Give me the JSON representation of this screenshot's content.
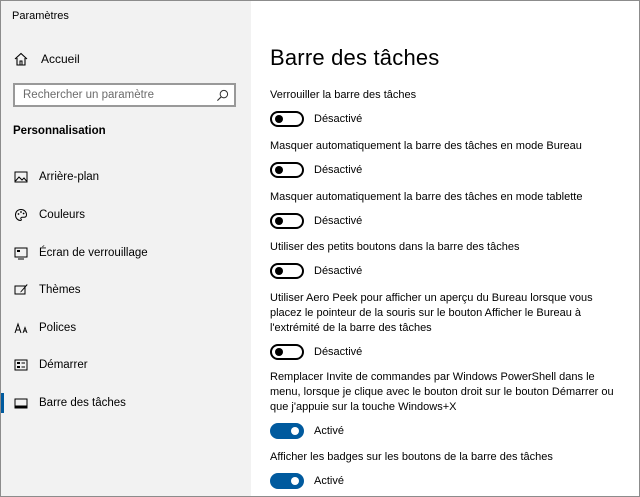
{
  "window": {
    "title": "Paramètres"
  },
  "sidebar": {
    "home_label": "Accueil",
    "search_placeholder": "Rechercher un paramètre",
    "section_title": "Personnalisation",
    "items": [
      {
        "label": "Arrière-plan",
        "icon": "picture-icon"
      },
      {
        "label": "Couleurs",
        "icon": "palette-icon"
      },
      {
        "label": "Écran de verrouillage",
        "icon": "lock-screen-icon"
      },
      {
        "label": "Thèmes",
        "icon": "brush-icon"
      },
      {
        "label": "Polices",
        "icon": "font-icon"
      },
      {
        "label": "Démarrer",
        "icon": "start-icon"
      },
      {
        "label": "Barre des tâches",
        "icon": "taskbar-icon",
        "active": true
      }
    ]
  },
  "main": {
    "title": "Barre des tâches",
    "settings": [
      {
        "description": "Verrouiller la barre des tâches",
        "state": "Désactivé",
        "on": false
      },
      {
        "description": "Masquer automatiquement la barre des tâches en mode Bureau",
        "state": "Désactivé",
        "on": false
      },
      {
        "description": "Masquer automatiquement la barre des tâches en mode tablette",
        "state": "Désactivé",
        "on": false
      },
      {
        "description": "Utiliser des petits boutons dans la barre des tâches",
        "state": "Désactivé",
        "on": false
      },
      {
        "description": "Utiliser Aero Peek pour afficher un aperçu du Bureau lorsque vous placez le pointeur de la souris sur le bouton Afficher le Bureau à l'extrémité de la barre des tâches",
        "state": "Désactivé",
        "on": false
      },
      {
        "description": "Remplacer Invite de commandes par Windows PowerShell dans le menu, lorsque je clique avec le bouton droit sur le bouton Démarrer ou que j'appuie sur la touche Windows+X",
        "state": "Activé",
        "on": true
      },
      {
        "description": "Afficher les badges sur les boutons de la barre des tâches",
        "state": "Activé",
        "on": true
      }
    ]
  },
  "colors": {
    "accent": "#005a9e",
    "sidebar_bg": "#f2f2f2"
  }
}
